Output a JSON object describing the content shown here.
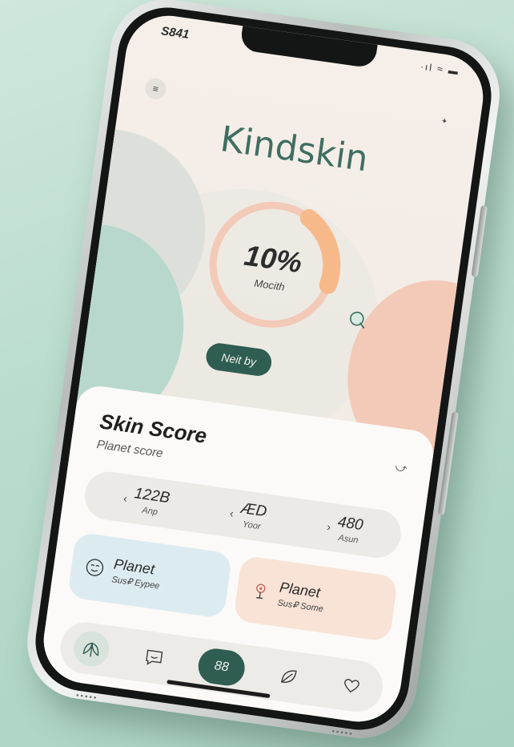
{
  "status_bar": {
    "time": "S841",
    "icons": "·ıl ≈ ▬"
  },
  "header": {
    "menu_icon": "menu-icon",
    "theme_icon": "sparkle-icon",
    "app_title": "Kindskin"
  },
  "progress": {
    "percent_label": "10%",
    "caption": "Mocith",
    "fraction": 0.1,
    "ring_color": "#f3c9b8",
    "fill_color": "#f7b98a"
  },
  "actions": {
    "next_label": "Neit by",
    "search_icon": "search-icon"
  },
  "card": {
    "title": "Skin Score",
    "subtitle": "Planet score",
    "share_icon": "share-arrow-icon",
    "stats": [
      {
        "value": "122B",
        "label": "Anp",
        "arrow": "‹"
      },
      {
        "value": "ÆD",
        "label": "Yoor",
        "arrow": "‹"
      },
      {
        "value": "480",
        "label": "Asun",
        "arrow": "›"
      }
    ],
    "tiles": [
      {
        "title": "Planet",
        "subtitle": "Sus₽ Eypee",
        "icon": "face-icon",
        "color": "#dcebf0"
      },
      {
        "title": "Planet",
        "subtitle": "Sus₽ Some",
        "icon": "pin-icon",
        "color": "#f8e3d6"
      }
    ]
  },
  "nav": {
    "items": [
      {
        "icon": "leaf-cluster-icon"
      },
      {
        "icon": "chat-icon"
      },
      {
        "label": "88"
      },
      {
        "icon": "leaf-icon"
      },
      {
        "icon": "heart-icon"
      }
    ],
    "accent": "#2f5d52"
  }
}
